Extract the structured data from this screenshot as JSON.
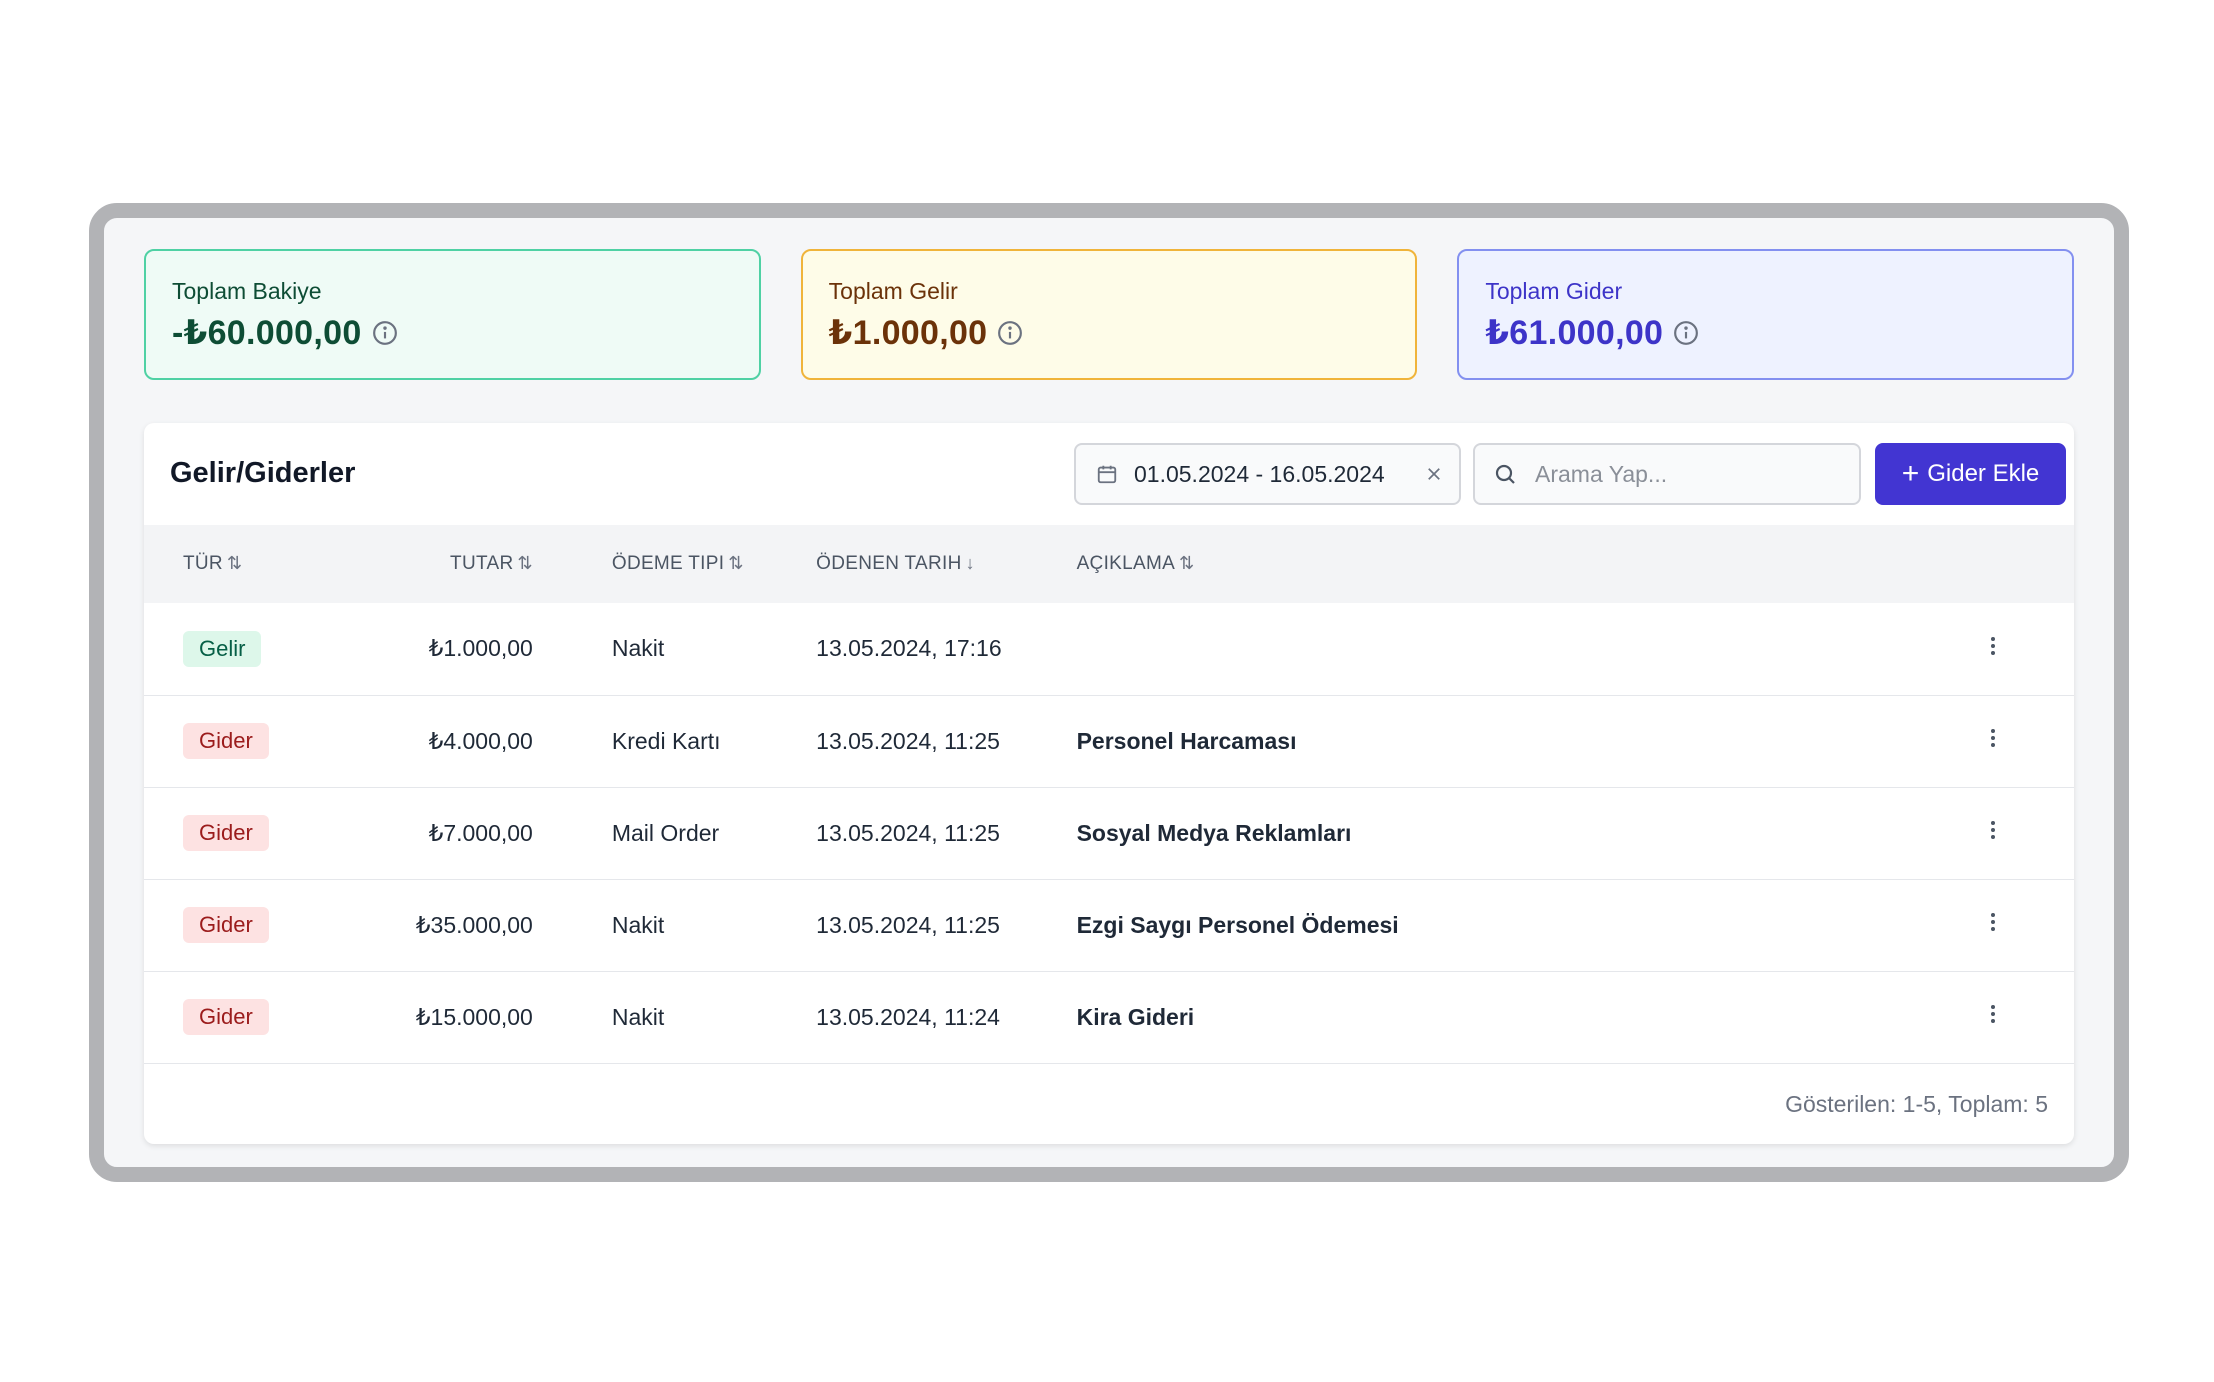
{
  "stats": [
    {
      "label": "Toplam Bakiye",
      "value": "-₺60.000,00",
      "color": "#0e4d35"
    },
    {
      "label": "Toplam Gelir",
      "value": "₺1.000,00",
      "color": "#6b3209"
    },
    {
      "label": "Toplam Gider",
      "value": "₺61.000,00",
      "color": "#3d34c8"
    }
  ],
  "panel": {
    "title": "Gelir/Giderler",
    "date_range": "01.05.2024 - 16.05.2024",
    "search_placeholder": "Arama Yap...",
    "add_button": "Gider Ekle",
    "accent_color": "#4235d2"
  },
  "table": {
    "columns": [
      "TÜR",
      "TUTAR",
      "ÖDEME TIPI",
      "ÖDENEN TARIH",
      "AÇIKLAMA"
    ],
    "rows": [
      {
        "type": "Gelir",
        "amount": "₺1.000,00",
        "payment": "Nakit",
        "date": "13.05.2024, 17:16",
        "desc": ""
      },
      {
        "type": "Gider",
        "amount": "₺4.000,00",
        "payment": "Kredi Kartı",
        "date": "13.05.2024, 11:25",
        "desc": "Personel Harcaması"
      },
      {
        "type": "Gider",
        "amount": "₺7.000,00",
        "payment": "Mail Order",
        "date": "13.05.2024, 11:25",
        "desc": "Sosyal Medya Reklamları"
      },
      {
        "type": "Gider",
        "amount": "₺35.000,00",
        "payment": "Nakit",
        "date": "13.05.2024, 11:25",
        "desc": "Ezgi Saygı Personel Ödemesi"
      },
      {
        "type": "Gider",
        "amount": "₺15.000,00",
        "payment": "Nakit",
        "date": "13.05.2024, 11:24",
        "desc": "Kira Gideri"
      }
    ]
  },
  "footer": {
    "text": "Gösterilen: 1-5, Toplam: 5"
  }
}
